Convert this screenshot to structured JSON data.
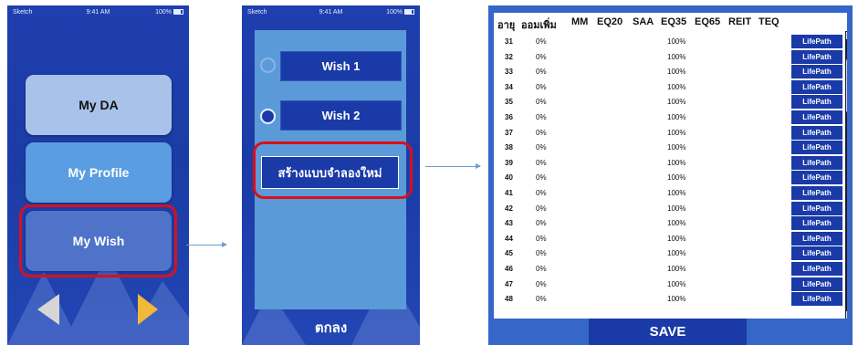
{
  "status_bar": {
    "carrier": "Sketch",
    "time": "9:41 AM",
    "battery": "100%"
  },
  "screen_menu": {
    "buttons": [
      {
        "label": "My DA"
      },
      {
        "label": "My Profile"
      },
      {
        "label": "My Wish"
      }
    ],
    "highlighted": "My Wish"
  },
  "screen_wishes": {
    "wishes": [
      {
        "label": "Wish 1",
        "selected": false
      },
      {
        "label": "Wish 2",
        "selected": true
      }
    ],
    "new_simulation_label": "สร้างแบบจำลองใหม่",
    "ok_label": "ตกลง"
  },
  "screen_table": {
    "columns": [
      "อายุ",
      "ออมเพิ่ม",
      "MM",
      "EQ20",
      "SAA",
      "EQ35",
      "EQ65",
      "REIT",
      "TEQ"
    ],
    "rows": [
      {
        "age": "31",
        "extra_saving": "0%",
        "eq35": "100%",
        "action": "LifePath"
      },
      {
        "age": "32",
        "extra_saving": "0%",
        "eq35": "100%",
        "action": "LifePath"
      },
      {
        "age": "33",
        "extra_saving": "0%",
        "eq35": "100%",
        "action": "LifePath"
      },
      {
        "age": "34",
        "extra_saving": "0%",
        "eq35": "100%",
        "action": "LifePath"
      },
      {
        "age": "35",
        "extra_saving": "0%",
        "eq35": "100%",
        "action": "LifePath"
      },
      {
        "age": "36",
        "extra_saving": "0%",
        "eq35": "100%",
        "action": "LifePath"
      },
      {
        "age": "37",
        "extra_saving": "0%",
        "eq35": "100%",
        "action": "LifePath"
      },
      {
        "age": "38",
        "extra_saving": "0%",
        "eq35": "100%",
        "action": "LifePath"
      },
      {
        "age": "39",
        "extra_saving": "0%",
        "eq35": "100%",
        "action": "LifePath"
      },
      {
        "age": "40",
        "extra_saving": "0%",
        "eq35": "100%",
        "action": "LifePath"
      },
      {
        "age": "41",
        "extra_saving": "0%",
        "eq35": "100%",
        "action": "LifePath"
      },
      {
        "age": "42",
        "extra_saving": "0%",
        "eq35": "100%",
        "action": "LifePath"
      },
      {
        "age": "43",
        "extra_saving": "0%",
        "eq35": "100%",
        "action": "LifePath"
      },
      {
        "age": "44",
        "extra_saving": "0%",
        "eq35": "100%",
        "action": "LifePath"
      },
      {
        "age": "45",
        "extra_saving": "0%",
        "eq35": "100%",
        "action": "LifePath"
      },
      {
        "age": "46",
        "extra_saving": "0%",
        "eq35": "100%",
        "action": "LifePath"
      },
      {
        "age": "47",
        "extra_saving": "0%",
        "eq35": "100%",
        "action": "LifePath"
      },
      {
        "age": "48",
        "extra_saving": "0%",
        "eq35": "100%",
        "action": "LifePath"
      }
    ],
    "save_label": "SAVE"
  },
  "colors": {
    "phone_background": "#1f3fae",
    "highlight_border": "#d9101a",
    "button_dark": "#1a3aa8",
    "nav_prev": "#d6d6d6",
    "nav_next": "#f2b83a"
  },
  "icons": {
    "nav_prev": "triangle-left-icon",
    "nav_next": "triangle-right-icon",
    "scroll_up": "caret-up-icon",
    "scroll_down": "caret-down-icon"
  }
}
